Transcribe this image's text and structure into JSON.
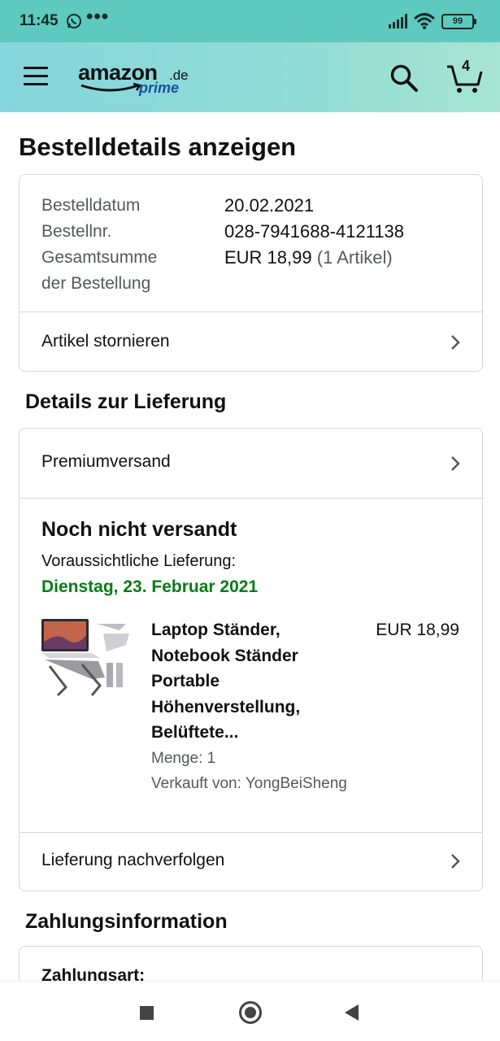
{
  "status_bar": {
    "time": "11:45",
    "dots": "•••",
    "battery": "99"
  },
  "header": {
    "logo_main": "amazon",
    "logo_suffix": ".de",
    "logo_sub": "prime",
    "cart_count": "4"
  },
  "page_title": "Bestelldetails anzeigen",
  "order_summary": {
    "date_label": "Bestelldatum",
    "date_value": "20.02.2021",
    "number_label": "Bestellnr.",
    "number_value": "028-7941688-4121138",
    "total_label_1": "Gesamtsumme",
    "total_label_2": "der Bestellung",
    "total_value": "EUR 18,99",
    "total_items": "(1 Artikel)",
    "cancel_link": "Artikel stornieren"
  },
  "delivery": {
    "section_title": "Details zur Lieferung",
    "shipping_method": "Premiumversand",
    "status": "Noch nicht versandt",
    "expected_label": "Voraussichtliche Lieferung:",
    "expected_date": "Dienstag, 23. Februar 2021",
    "product": {
      "title_lines": [
        "Laptop Ständer,",
        "Notebook Ständer",
        "Portable",
        "Höhenverstellung,",
        "Belüftete..."
      ],
      "price": "EUR 18,99",
      "quantity": "Menge: 1",
      "seller": "Verkauft von: YongBeiSheng"
    },
    "track_link": "Lieferung nachverfolgen"
  },
  "payment": {
    "section_title": "Zahlungsinformation",
    "method_label": "Zahlungsart:"
  },
  "colors": {
    "status_bar": "#5ec9bf",
    "header_start": "#85d6dd",
    "header_end": "#a7e5d2",
    "delivery_green": "#067d17",
    "prime_blue": "#1a4fa3"
  }
}
